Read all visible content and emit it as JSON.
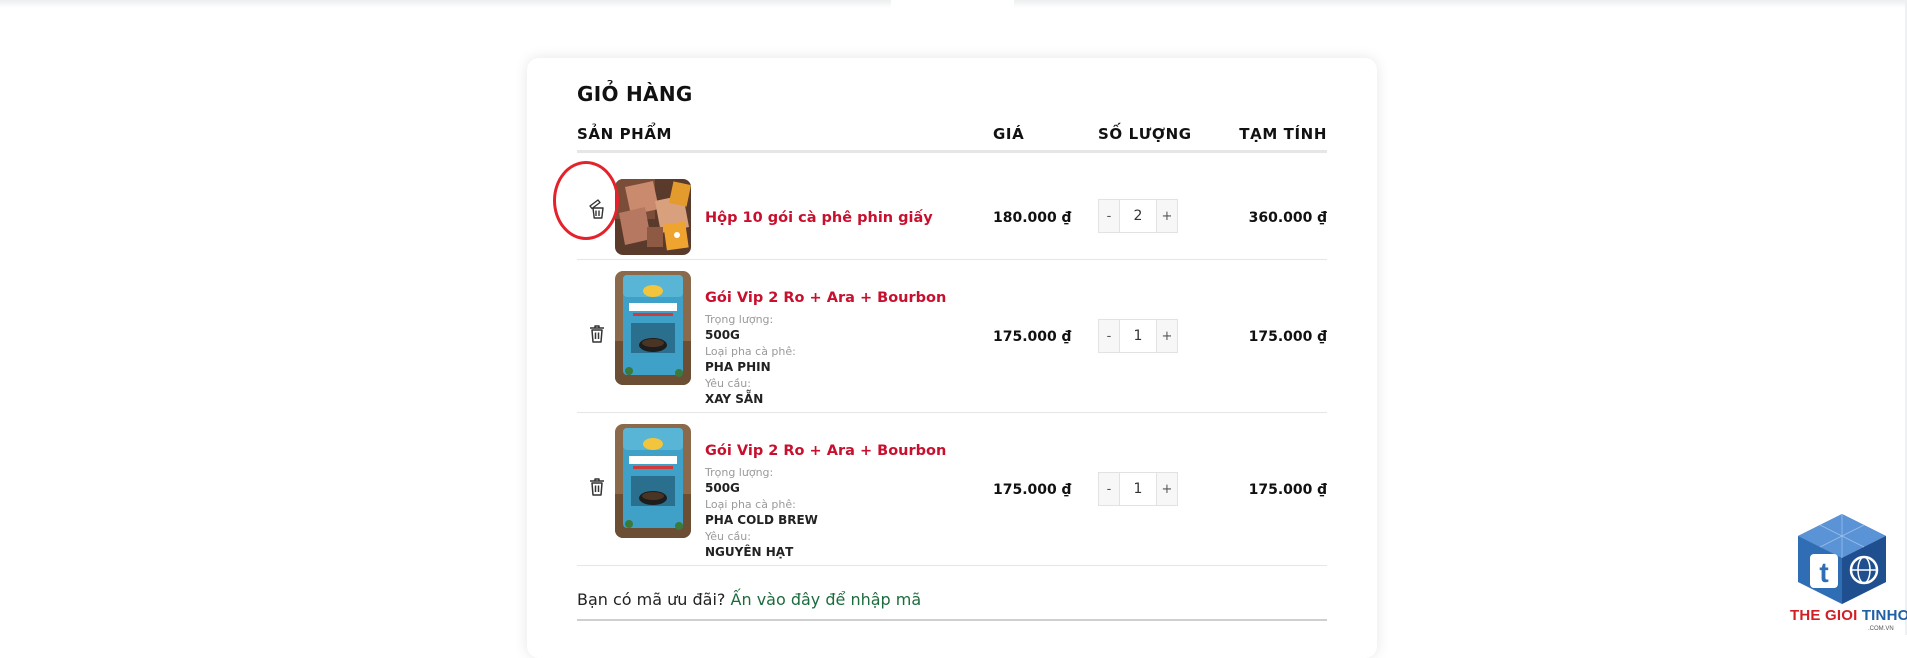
{
  "cart": {
    "title": "GIỎ HÀNG",
    "headers": {
      "product": "SẢN PHẨM",
      "price": "GIÁ",
      "quantity": "SỐ LƯỢNG",
      "subtotal": "TẠM TÍNH"
    },
    "items": [
      {
        "name": "Hộp 10 gói cà phê phin giấy",
        "price": "180.000 ₫",
        "quantity": "2",
        "subtotal": "360.000 ₫",
        "minus": "-",
        "plus": "+",
        "thumb_icon": "coffee-box-image"
      },
      {
        "name": "Gói Vip 2 Ro + Ara + Bourbon",
        "meta": [
          {
            "label": "Trọng lượng:",
            "value": "500G"
          },
          {
            "label": "Loại pha cà phê:",
            "value": "PHA PHIN"
          },
          {
            "label": "Yêu cầu:",
            "value": "XAY SẴN"
          }
        ],
        "price": "175.000 ₫",
        "quantity": "1",
        "subtotal": "175.000 ₫",
        "minus": "-",
        "plus": "+",
        "thumb_icon": "coffee-bag-image"
      },
      {
        "name": "Gói Vip 2 Ro + Ara + Bourbon",
        "meta": [
          {
            "label": "Trọng lượng:",
            "value": "500G"
          },
          {
            "label": "Loại pha cà phê:",
            "value": "PHA COLD BREW"
          },
          {
            "label": "Yêu cầu:",
            "value": "NGUYÊN HẠT"
          }
        ],
        "price": "175.000 ₫",
        "quantity": "1",
        "subtotal": "175.000 ₫",
        "minus": "-",
        "plus": "+",
        "thumb_icon": "coffee-bag-image"
      }
    ],
    "coupon": {
      "prompt": "Bạn có mã ưu đãi?",
      "link": "Ấn vào đây để nhập mã"
    }
  },
  "watermark": {
    "part1": "THE GIOI",
    "part2": "TINHOC",
    "sub": ".COM.VN"
  },
  "colors": {
    "accent_red": "#c8102e",
    "link_green": "#1c6b3c",
    "highlight_ring": "#e4222b"
  }
}
